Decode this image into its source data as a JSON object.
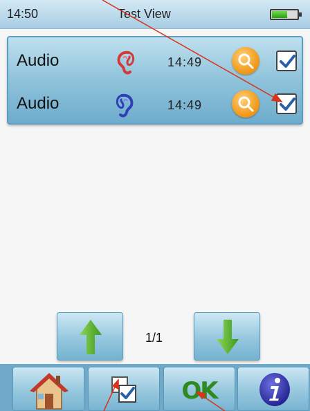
{
  "status_bar": {
    "time": "14:50",
    "title": "Test View",
    "battery_level": 0.58
  },
  "results": [
    {
      "label": "Audio",
      "ear": "left-ear-icon",
      "ear_color": "#d23a3a",
      "time": "14:49",
      "checked": true
    },
    {
      "label": "Audio",
      "ear": "right-ear-icon",
      "ear_color": "#2f3fb8",
      "time": "14:49",
      "checked": true
    }
  ],
  "pager": {
    "page_indicator": "1/1",
    "up_icon": "arrow-up-icon",
    "down_icon": "arrow-down-icon"
  },
  "toolbar": {
    "home_icon": "home-icon",
    "select_icon": "select-all-icon",
    "ok_label": "OK",
    "info_icon": "info-icon"
  },
  "colors": {
    "accent_blue": "#8fc3db",
    "arrow_green": "#4fae2a",
    "zoom_orange": "#f29c1e",
    "annotation_red": "#d8341c"
  }
}
